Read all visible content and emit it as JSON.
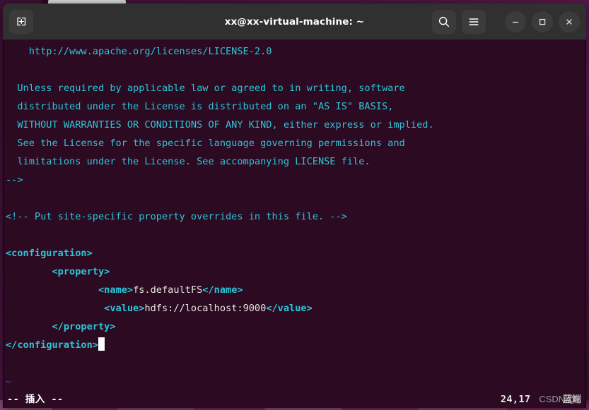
{
  "window": {
    "title": "xx@xx-virtual-machine: ~",
    "titlebar": {
      "new_tab_label": "new-tab",
      "search_label": "search",
      "menu_label": "menu",
      "minimize_label": "minimize",
      "maximize_label": "maximize",
      "close_label": "close"
    },
    "colors": {
      "titlebar_bg": "#303030",
      "terminal_bg": "#2c0a22",
      "comment": "#2dc5d6",
      "tag": "#2dc5d6",
      "text": "#e8e6e3",
      "tilde": "#3b4cc9",
      "cursor": "#ffffff"
    }
  },
  "terminal": {
    "lines": [
      {
        "segments": [
          {
            "text": "    http://www.apache.org/licenses/LICENSE-2.0",
            "style": "cyan"
          }
        ]
      },
      {
        "segments": [
          {
            "text": "",
            "style": "cyan"
          }
        ]
      },
      {
        "segments": [
          {
            "text": "  Unless required by applicable law or agreed to in writing, software",
            "style": "cyan"
          }
        ]
      },
      {
        "segments": [
          {
            "text": "  distributed under the License is distributed on an \"AS IS\" BASIS,",
            "style": "cyan"
          }
        ]
      },
      {
        "segments": [
          {
            "text": "  WITHOUT WARRANTIES OR CONDITIONS OF ANY KIND, either express or implied.",
            "style": "cyan"
          }
        ]
      },
      {
        "segments": [
          {
            "text": "  See the License for the specific language governing permissions and",
            "style": "cyan"
          }
        ]
      },
      {
        "segments": [
          {
            "text": "  limitations under the License. See accompanying LICENSE file.",
            "style": "cyan"
          }
        ]
      },
      {
        "segments": [
          {
            "text": "-->",
            "style": "cyan"
          }
        ]
      },
      {
        "segments": [
          {
            "text": "",
            "style": "cyan"
          }
        ]
      },
      {
        "segments": [
          {
            "text": "<!-- Put site-specific property overrides in this file. -->",
            "style": "cyan"
          }
        ]
      },
      {
        "segments": [
          {
            "text": "",
            "style": "cyan"
          }
        ]
      },
      {
        "segments": [
          {
            "text": "<configuration>",
            "style": "cyan-b"
          }
        ]
      },
      {
        "segments": [
          {
            "text": "        <property>",
            "style": "cyan-b"
          }
        ]
      },
      {
        "segments": [
          {
            "text": "                ",
            "style": "white"
          },
          {
            "text": "<name>",
            "style": "cyan-b"
          },
          {
            "text": "fs.defaultFS",
            "style": "white"
          },
          {
            "text": "</name>",
            "style": "cyan-b"
          }
        ]
      },
      {
        "segments": [
          {
            "text": "                 ",
            "style": "white"
          },
          {
            "text": "<value>",
            "style": "cyan-b"
          },
          {
            "text": "hdfs://localhost:9000",
            "style": "white"
          },
          {
            "text": "</value>",
            "style": "cyan-b"
          }
        ]
      },
      {
        "segments": [
          {
            "text": "        </property>",
            "style": "cyan-b"
          }
        ]
      },
      {
        "segments": [
          {
            "text": "</configuration>",
            "style": "cyan-b",
            "cursor_after": true
          }
        ]
      },
      {
        "segments": [
          {
            "text": "",
            "style": "cyan"
          }
        ]
      },
      {
        "segments": [
          {
            "text": "~",
            "style": "blue"
          }
        ]
      }
    ]
  },
  "statusline": {
    "mode": "-- 插入 --",
    "position": "24,17",
    "watermark_prefix": "CSDN @",
    "watermark_handle": "蓝端"
  }
}
